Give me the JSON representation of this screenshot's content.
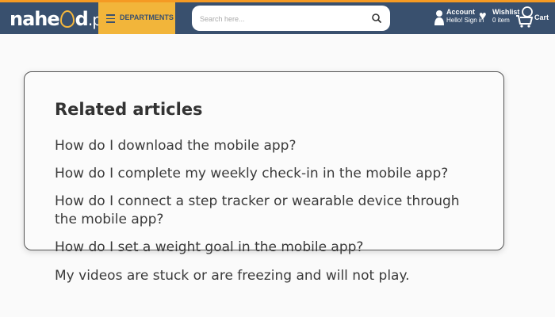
{
  "header": {
    "logo": {
      "part1": "nahe",
      "part2": "d",
      "part3": ".pk"
    },
    "departments_label": "DEPARTMENTS ▾",
    "search": {
      "placeholder": "Search here..."
    },
    "account": {
      "title": "Account",
      "subtitle": "Hello! Sign in"
    },
    "wishlist": {
      "title": "Wishlist",
      "subtitle": "0 item"
    },
    "cart": {
      "title": "Cart"
    },
    "colors": {
      "header_bg": "#39506e",
      "accent": "#f2b53a",
      "top_line": "#f59a23"
    }
  },
  "related": {
    "title": "Related articles",
    "articles": [
      "How do I download the mobile app?",
      "How do I complete my weekly check-in in the mobile app?",
      "How do I connect a step tracker or wearable device through",
      "the mobile app?",
      "How do I set a weight goal in the mobile app?",
      "My videos are stuck or are freezing and will not play."
    ]
  }
}
